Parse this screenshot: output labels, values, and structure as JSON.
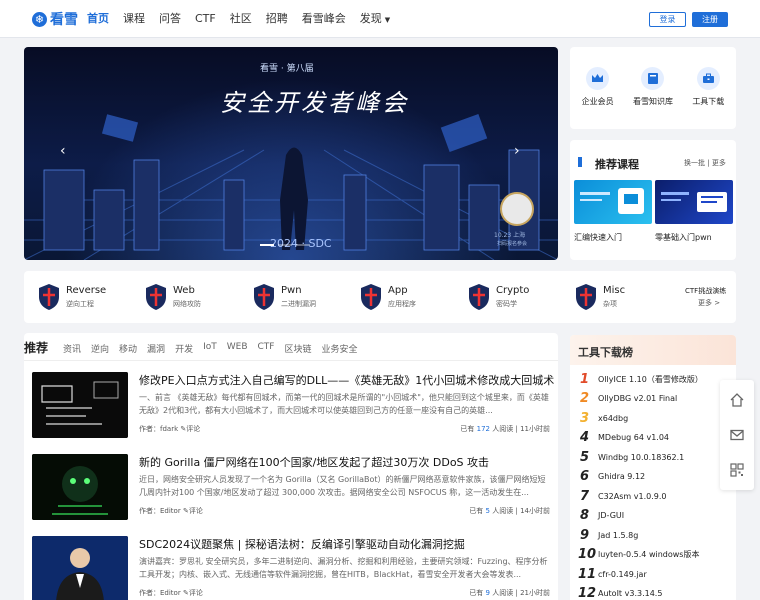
{
  "nav": {
    "logo_text": "看雪",
    "items": [
      {
        "label": "首页",
        "active": true
      },
      {
        "label": "课程"
      },
      {
        "label": "问答"
      },
      {
        "label": "CTF"
      },
      {
        "label": "社区"
      },
      {
        "label": "招聘"
      },
      {
        "label": "看雪峰会"
      },
      {
        "label": "发现",
        "dropdown": true
      }
    ],
    "login": "登录",
    "register": "注册"
  },
  "banner": {
    "subtitle": "看雪 · 第八届",
    "title": "安全开发者峰会",
    "year": "2024 · SDC",
    "date": "10.23 上海",
    "qr_caption": "扫码报名参会"
  },
  "quick_links": [
    {
      "label": "企业会员",
      "icon": "crown-icon"
    },
    {
      "label": "看雪知识库",
      "icon": "book-icon"
    },
    {
      "label": "工具下载",
      "icon": "toolbox-icon"
    }
  ],
  "recommend": {
    "title": "推荐课程",
    "refresh": "换一批",
    "more": "更多",
    "courses": [
      {
        "title": "汇编快速入门"
      },
      {
        "title": "零基础入门pwn"
      }
    ]
  },
  "categories": [
    {
      "name": "Reverse",
      "sub": "逆向工程"
    },
    {
      "name": "Web",
      "sub": "网络攻防"
    },
    {
      "name": "Pwn",
      "sub": "二进制漏洞"
    },
    {
      "name": "App",
      "sub": "应用程序"
    },
    {
      "name": "Crypto",
      "sub": "密码学"
    },
    {
      "name": "Misc",
      "sub": "杂项"
    }
  ],
  "ctf": {
    "title": "CTF挑战演练",
    "more": "更多 >"
  },
  "feed": {
    "title": "推荐",
    "tabs": [
      "资讯",
      "逆向",
      "移动",
      "漏洞",
      "开发",
      "IoT",
      "WEB",
      "CTF",
      "区块链",
      "业务安全"
    ],
    "articles": [
      {
        "title": "修改PE入口点方式注入自己编写的DLL——《英雄无敌》1代小回城术修改成大回城术",
        "desc": "一、前言 《英雄无敌》每代都有回城术，而第一代的回城术是所谓的\"小回城术\"，他只能回到这个城里来，而《英雄无敌》2代和3代，都有大小回城术了，而大回城术可以使英雄回到己方的任意一座没有自己的英雄...",
        "author": "作者：fdark",
        "comment": "评论",
        "reads_prefix": "已有",
        "reads": "172",
        "reads_suffix": "人阅读",
        "time": "11小时前"
      },
      {
        "title": "新的 Gorilla 僵尸网络在100个国家/地区发起了超过30万次 DDoS 攻击",
        "desc": "近日，网络安全研究人员发现了一个名为 Gorilla（又名 GorillaBot）的新僵尸网络恶意软件家族，该僵尸网络短短几周内针对100 个国家/地区发动了超过 300,000 次攻击。据网络安全公司 NSFOCUS 称，这一活动发生在...",
        "author": "作者：Editor",
        "comment": "评论",
        "reads_prefix": "已有",
        "reads": "5",
        "reads_suffix": "人阅读",
        "time": "14小时前"
      },
      {
        "title": "SDC2024议题聚焦 | 探秘语法树：反编译引擎驱动自动化漏洞挖掘",
        "desc": "演讲嘉宾：罗思礼 安全研究员，多年二进制逆向、漏洞分析、挖掘和利用经验，主要研究领域：Fuzzing、程序分析工具开发；内核、嵌入式、无线通信等软件漏洞挖掘，曾在HITB，BlackHat，看雪安全开发者大会等发表...",
        "author": "作者：Editor",
        "comment": "评论",
        "reads_prefix": "已有",
        "reads": "9",
        "reads_suffix": "人阅读",
        "time": "21小时前"
      }
    ]
  },
  "tools": {
    "title": "工具下载榜",
    "items": [
      {
        "rank": "1",
        "name": "OllyICE 1.10（看雪修改版）",
        "color": "#e14b2a"
      },
      {
        "rank": "2",
        "name": "OllyDBG v2.01 Final",
        "color": "#f08a24"
      },
      {
        "rank": "3",
        "name": "x64dbg",
        "color": "#f3b130"
      },
      {
        "rank": "4",
        "name": "MDebug 64 v1.04",
        "color": "#222222"
      },
      {
        "rank": "5",
        "name": "Windbg 10.0.18362.1",
        "color": "#222222"
      },
      {
        "rank": "6",
        "name": "Ghidra 9.12",
        "color": "#222222"
      },
      {
        "rank": "7",
        "name": "C32Asm v1.0.9.0",
        "color": "#222222"
      },
      {
        "rank": "8",
        "name": "JD-GUI",
        "color": "#222222"
      },
      {
        "rank": "9",
        "name": "Jad 1.5.8g",
        "color": "#222222"
      },
      {
        "rank": "10",
        "name": "luyten-0.5.4 windows版本",
        "color": "#222222"
      },
      {
        "rank": "11",
        "name": "cfr-0.149.jar",
        "color": "#222222"
      },
      {
        "rank": "12",
        "name": "AutoIt v3.3.14.5",
        "color": "#222222"
      }
    ]
  },
  "floating": [
    {
      "icon": "home-icon"
    },
    {
      "icon": "mail-icon"
    },
    {
      "icon": "qrcode-icon"
    }
  ]
}
